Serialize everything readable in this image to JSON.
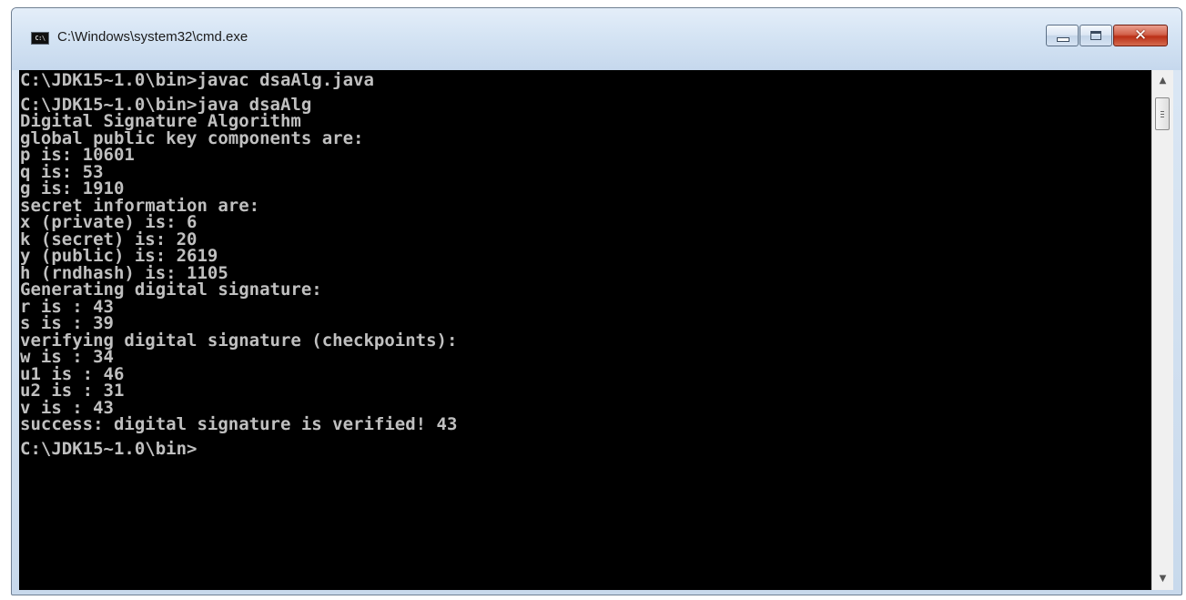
{
  "window": {
    "title": "C:\\Windows\\system32\\cmd.exe",
    "icon_text": "C:\\"
  },
  "controls": {
    "close_glyph": "✕"
  },
  "scrollbar": {
    "up_arrow": "▲",
    "down_arrow": "▼"
  },
  "console": {
    "lines": [
      "C:\\JDK15~1.0\\bin>javac dsaAlg.java",
      "",
      "C:\\JDK15~1.0\\bin>java dsaAlg",
      "Digital Signature Algorithm",
      "global public key components are:",
      "p is: 10601",
      "q is: 53",
      "g is: 1910",
      "secret information are:",
      "x (private) is: 6",
      "k (secret) is: 20",
      "y (public) is: 2619",
      "h (rndhash) is: 1105",
      "Generating digital signature:",
      "r is : 43",
      "s is : 39",
      "verifying digital signature (checkpoints):",
      "w is : 34",
      "u1 is : 46",
      "u2 is : 31",
      "v is : 43",
      "success: digital signature is verified! 43",
      "",
      "C:\\JDK15~1.0\\bin>"
    ]
  }
}
